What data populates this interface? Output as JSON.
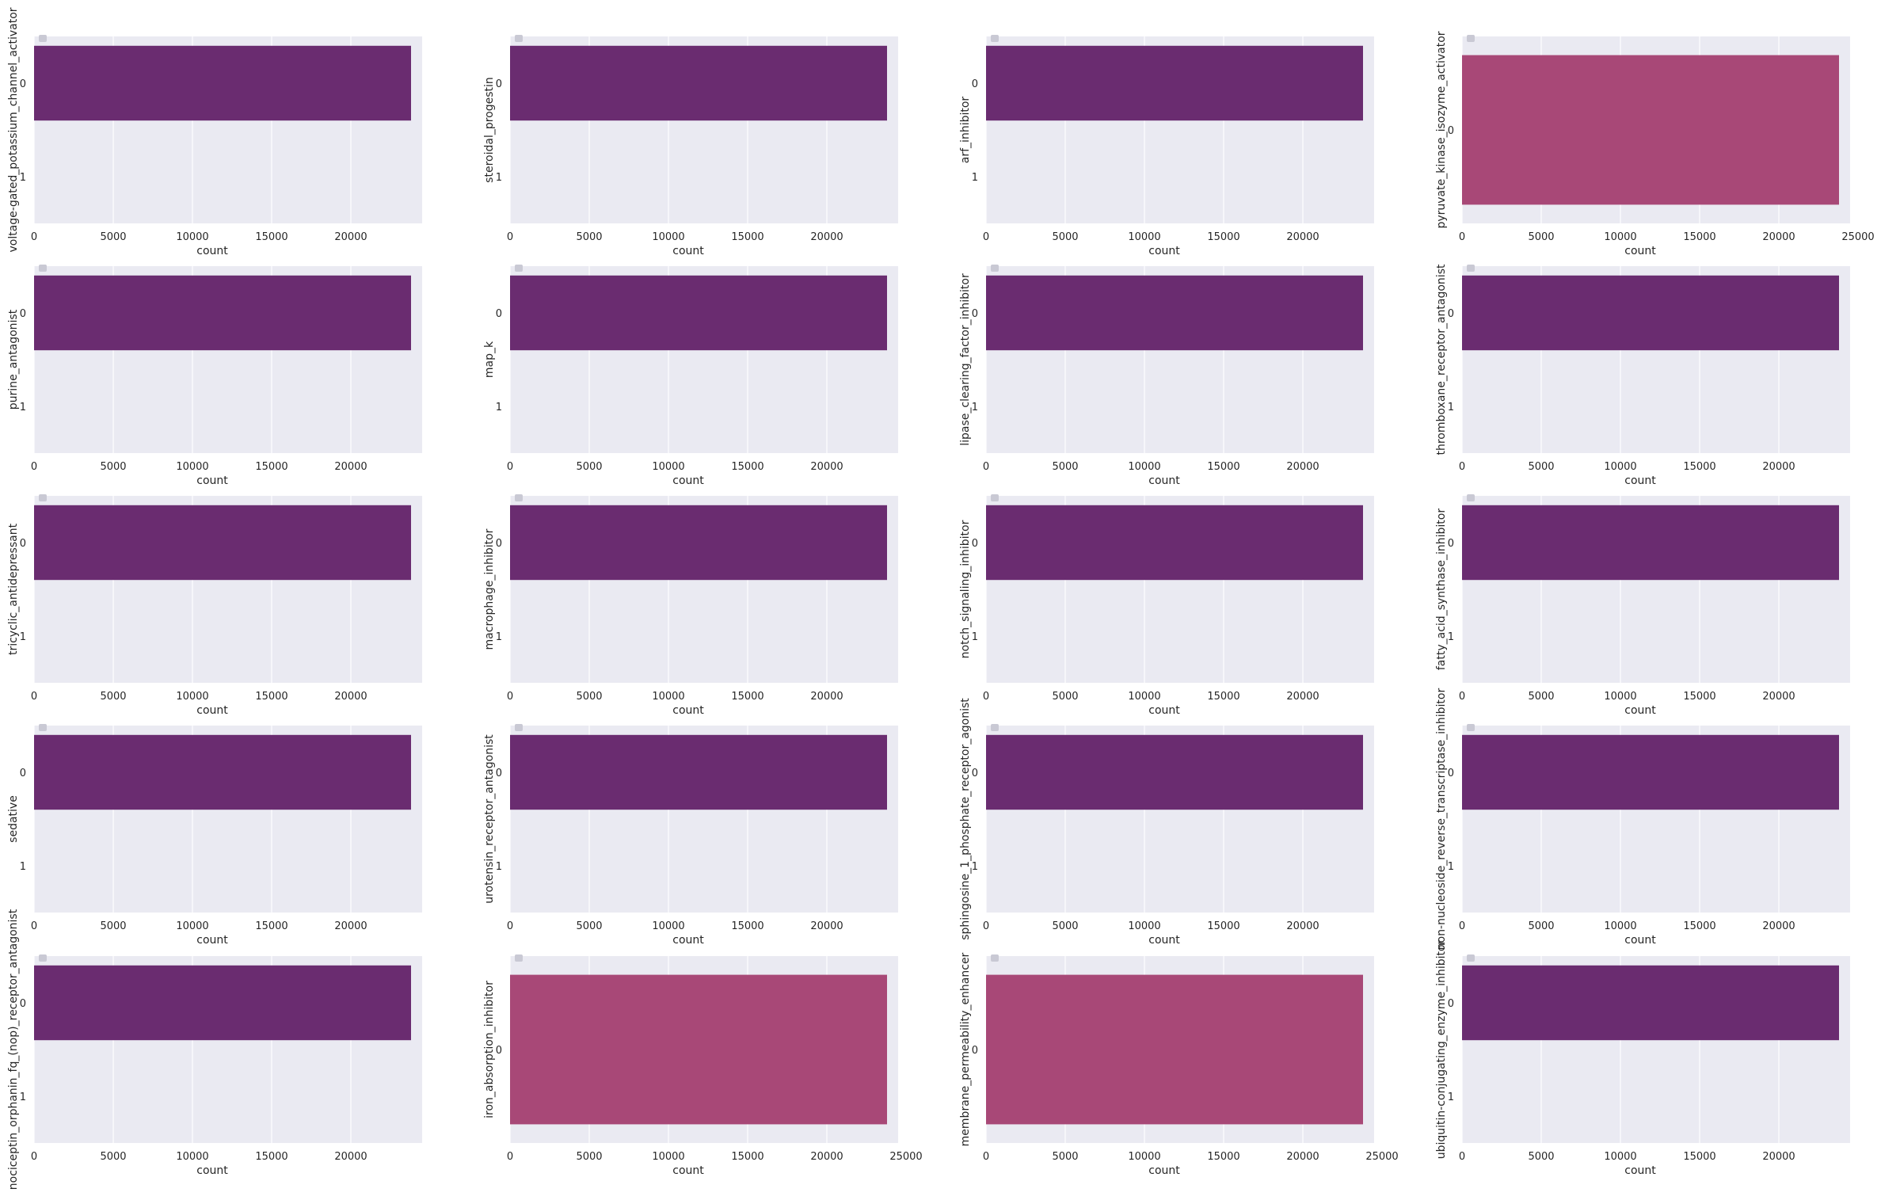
{
  "figure": {
    "colors": {
      "background": "#eaeaf2",
      "grid": "#ffffff",
      "text": "#262626",
      "bar_two_class": "#6a2c70",
      "bar_one_class": "#a84877",
      "legend_marker": "#c9c9d4"
    }
  },
  "chart_data": [
    {
      "type": "bar",
      "orientation": "horizontal",
      "ylabel": "voltage-gated_potassium_channel_activator",
      "xlabel": "count",
      "categories": [
        "0",
        "1"
      ],
      "values": [
        23800,
        0
      ],
      "xlim": [
        0,
        25000
      ],
      "xticks": [
        "0",
        "5000",
        "10000",
        "15000",
        "20000"
      ],
      "grid": true
    },
    {
      "type": "bar",
      "orientation": "horizontal",
      "ylabel": "steroidal_progestin",
      "xlabel": "count",
      "categories": [
        "0",
        "1"
      ],
      "values": [
        23800,
        0
      ],
      "xlim": [
        0,
        25000
      ],
      "xticks": [
        "0",
        "5000",
        "10000",
        "15000",
        "20000"
      ],
      "grid": true
    },
    {
      "type": "bar",
      "orientation": "horizontal",
      "ylabel": "arf_inhibitor",
      "xlabel": "count",
      "categories": [
        "0",
        "1"
      ],
      "values": [
        23800,
        0
      ],
      "xlim": [
        0,
        25000
      ],
      "xticks": [
        "0",
        "5000",
        "10000",
        "15000",
        "20000"
      ],
      "grid": true
    },
    {
      "type": "bar",
      "orientation": "horizontal",
      "ylabel": "pyruvate_kinase_isozyme_activator",
      "xlabel": "count",
      "categories": [
        "0"
      ],
      "values": [
        23800
      ],
      "xlim": [
        0,
        25000
      ],
      "xticks": [
        "0",
        "5000",
        "10000",
        "15000",
        "20000",
        "25000"
      ],
      "grid": true
    },
    {
      "type": "bar",
      "orientation": "horizontal",
      "ylabel": "purine_antagonist",
      "xlabel": "count",
      "categories": [
        "0",
        "1"
      ],
      "values": [
        23800,
        0
      ],
      "xlim": [
        0,
        25000
      ],
      "xticks": [
        "0",
        "5000",
        "10000",
        "15000",
        "20000"
      ],
      "grid": true
    },
    {
      "type": "bar",
      "orientation": "horizontal",
      "ylabel": "map_k",
      "xlabel": "count",
      "categories": [
        "0",
        "1"
      ],
      "values": [
        23800,
        0
      ],
      "xlim": [
        0,
        25000
      ],
      "xticks": [
        "0",
        "5000",
        "10000",
        "15000",
        "20000"
      ],
      "grid": true
    },
    {
      "type": "bar",
      "orientation": "horizontal",
      "ylabel": "lipase_clearing_factor_inhibitor",
      "xlabel": "count",
      "categories": [
        "0",
        "1"
      ],
      "values": [
        23800,
        0
      ],
      "xlim": [
        0,
        25000
      ],
      "xticks": [
        "0",
        "5000",
        "10000",
        "15000",
        "20000"
      ],
      "grid": true
    },
    {
      "type": "bar",
      "orientation": "horizontal",
      "ylabel": "thromboxane_receptor_antagonist",
      "xlabel": "count",
      "categories": [
        "0",
        "1"
      ],
      "values": [
        23800,
        0
      ],
      "xlim": [
        0,
        25000
      ],
      "xticks": [
        "0",
        "5000",
        "10000",
        "15000",
        "20000"
      ],
      "grid": true
    },
    {
      "type": "bar",
      "orientation": "horizontal",
      "ylabel": "tricyclic_antidepressant",
      "xlabel": "count",
      "categories": [
        "0",
        "1"
      ],
      "values": [
        23800,
        0
      ],
      "xlim": [
        0,
        25000
      ],
      "xticks": [
        "0",
        "5000",
        "10000",
        "15000",
        "20000"
      ],
      "grid": true
    },
    {
      "type": "bar",
      "orientation": "horizontal",
      "ylabel": "macrophage_inhibitor",
      "xlabel": "count",
      "categories": [
        "0",
        "1"
      ],
      "values": [
        23800,
        0
      ],
      "xlim": [
        0,
        25000
      ],
      "xticks": [
        "0",
        "5000",
        "10000",
        "15000",
        "20000"
      ],
      "grid": true
    },
    {
      "type": "bar",
      "orientation": "horizontal",
      "ylabel": "notch_signaling_inhibitor",
      "xlabel": "count",
      "categories": [
        "0",
        "1"
      ],
      "values": [
        23800,
        0
      ],
      "xlim": [
        0,
        25000
      ],
      "xticks": [
        "0",
        "5000",
        "10000",
        "15000",
        "20000"
      ],
      "grid": true
    },
    {
      "type": "bar",
      "orientation": "horizontal",
      "ylabel": "fatty_acid_synthase_inhibitor",
      "xlabel": "count",
      "categories": [
        "0",
        "1"
      ],
      "values": [
        23800,
        0
      ],
      "xlim": [
        0,
        25000
      ],
      "xticks": [
        "0",
        "5000",
        "10000",
        "15000",
        "20000"
      ],
      "grid": true
    },
    {
      "type": "bar",
      "orientation": "horizontal",
      "ylabel": "sedative",
      "xlabel": "count",
      "categories": [
        "0",
        "1"
      ],
      "values": [
        23800,
        0
      ],
      "xlim": [
        0,
        25000
      ],
      "xticks": [
        "0",
        "5000",
        "10000",
        "15000",
        "20000"
      ],
      "grid": true
    },
    {
      "type": "bar",
      "orientation": "horizontal",
      "ylabel": "urotensin_receptor_antagonist",
      "xlabel": "count",
      "categories": [
        "0",
        "1"
      ],
      "values": [
        23800,
        0
      ],
      "xlim": [
        0,
        25000
      ],
      "xticks": [
        "0",
        "5000",
        "10000",
        "15000",
        "20000"
      ],
      "grid": true
    },
    {
      "type": "bar",
      "orientation": "horizontal",
      "ylabel": "sphingosine_1_phosphate_receptor_agonist",
      "xlabel": "count",
      "categories": [
        "0",
        "1"
      ],
      "values": [
        23800,
        0
      ],
      "xlim": [
        0,
        25000
      ],
      "xticks": [
        "0",
        "5000",
        "10000",
        "15000",
        "20000"
      ],
      "grid": true
    },
    {
      "type": "bar",
      "orientation": "horizontal",
      "ylabel": "non-nucleoside_reverse_transcriptase_inhibitor",
      "xlabel": "count",
      "categories": [
        "0",
        "1"
      ],
      "values": [
        23800,
        0
      ],
      "xlim": [
        0,
        25000
      ],
      "xticks": [
        "0",
        "5000",
        "10000",
        "15000",
        "20000"
      ],
      "grid": true
    },
    {
      "type": "bar",
      "orientation": "horizontal",
      "ylabel": "nociceptin_orphanin_fq_(nop)_receptor_antagonist",
      "xlabel": "count",
      "categories": [
        "0",
        "1"
      ],
      "values": [
        23800,
        0
      ],
      "xlim": [
        0,
        25000
      ],
      "xticks": [
        "0",
        "5000",
        "10000",
        "15000",
        "20000"
      ],
      "grid": true
    },
    {
      "type": "bar",
      "orientation": "horizontal",
      "ylabel": "iron_absorption_inhibitor",
      "xlabel": "count",
      "categories": [
        "0"
      ],
      "values": [
        23800
      ],
      "xlim": [
        0,
        25000
      ],
      "xticks": [
        "0",
        "5000",
        "10000",
        "15000",
        "20000",
        "25000"
      ],
      "grid": true
    },
    {
      "type": "bar",
      "orientation": "horizontal",
      "ylabel": "membrane_permeability_enhancer",
      "xlabel": "count",
      "categories": [
        "0"
      ],
      "values": [
        23800
      ],
      "xlim": [
        0,
        25000
      ],
      "xticks": [
        "0",
        "5000",
        "10000",
        "15000",
        "20000",
        "25000"
      ],
      "grid": true
    },
    {
      "type": "bar",
      "orientation": "horizontal",
      "ylabel": "ubiquitin-conjugating_enzyme_inhibitor",
      "xlabel": "count",
      "categories": [
        "0",
        "1"
      ],
      "values": [
        23800,
        0
      ],
      "xlim": [
        0,
        25000
      ],
      "xticks": [
        "0",
        "5000",
        "10000",
        "15000",
        "20000"
      ],
      "grid": true
    }
  ]
}
